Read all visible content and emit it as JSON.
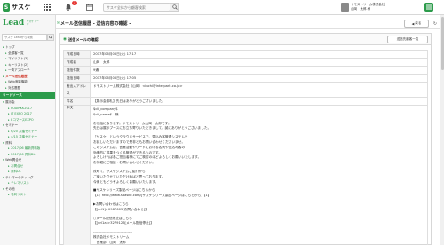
{
  "topbar": {
    "logo_mark": "S",
    "logo_text": "サスケ",
    "bell_count": "3",
    "search_placeholder": "サスケ全体から顧客検索",
    "user_org": "ドモストリーム株式会社",
    "user_name": "山岡　太郎 様"
  },
  "sidebar": {
    "logo": "Lead",
    "logo_sub": "サスケ リード",
    "search_placeholder": "サスケ Leadから検索",
    "items_top": [
      {
        "label": "トップ",
        "type": "plain"
      },
      {
        "label": "全顧客一覧",
        "type": "sub"
      },
      {
        "label": "マイリスト(3)",
        "type": "sub"
      },
      {
        "label": "キーリスト(2)",
        "type": "sub"
      },
      {
        "label": "一斉アプローチ",
        "type": "sub"
      },
      {
        "label": "メール送信履歴",
        "type": "active"
      },
      {
        "label": "Web追跡機能",
        "type": "sub"
      },
      {
        "label": "対応履歴",
        "type": "sub"
      }
    ],
    "section_label": "リードソース",
    "items_source": [
      {
        "label": "展示会",
        "type": "head"
      },
      {
        "label": "PUAIRKK2017",
        "type": "sub2"
      },
      {
        "label": "IT EXPO 2017",
        "type": "sub2"
      },
      {
        "label": "EコマースEXPO",
        "type": "sub2"
      },
      {
        "label": "セミナー",
        "type": "head"
      },
      {
        "label": "6/20 共催セミナー",
        "type": "sub2"
      },
      {
        "label": "4/15 共催セミナー",
        "type": "sub2"
      },
      {
        "label": "資料",
        "type": "head"
      },
      {
        "label": "2017/06 最新資料版",
        "type": "sub2"
      },
      {
        "label": "2017/06 資料DL",
        "type": "sub2"
      },
      {
        "label": "Web問合せ",
        "type": "head"
      },
      {
        "label": "お問合せ",
        "type": "sub2"
      },
      {
        "label": "資料DL",
        "type": "sub2"
      },
      {
        "label": "テレマーケティング",
        "type": "head"
      },
      {
        "label": "テレマリスト",
        "type": "sub2"
      },
      {
        "label": "その他",
        "type": "head"
      },
      {
        "label": "名刺リスト",
        "type": "sub2"
      }
    ]
  },
  "page": {
    "title": "メール送信履歴 - 送信内容の確認 -",
    "back_label": "戻る",
    "panel_title": "送信メールの確認",
    "list_button": "送信先顧客一覧",
    "rows": [
      {
        "label": "作成日時",
        "value": "2017年06月06日(火) 17:17"
      },
      {
        "label": "作成者",
        "value": "山岡　太郎"
      },
      {
        "label": "送信件数",
        "value": "9通"
      },
      {
        "label": "送信日時",
        "value": "2017年06月06日(火) 17:05"
      },
      {
        "label": "差出人アドレス",
        "value": "ドモストリーム株式会社（山岡）<inchi@interpark.co.jp>"
      },
      {
        "label": "件名",
        "value": "【展示会御礼】先日はありがとうございました。"
      }
    ],
    "body_label": "本文",
    "body_lines": [
      "$cli_company$",
      "$cli_name$　様",
      "",
      "お世話になります。ドモストリーム山岡　太郎です。",
      "先日は展示ブースにお立ち寄りいただきまして、誠にありがとうございました。",
      "",
      "「サスケ」というクラウドサービスで、見込み客管理システムを",
      "お試しいただけますので是非ともお問い合わせくださいませ。",
      "このシステムは、営業活動やリードにおける名刺や見込み客の",
      "効率的に成果をつくる管理ができるものです。",
      "よろしければ各ご担当者様にてご検討のほどよろしくお願いいたします。",
      "お気軽にご相談・お問い合わせください。",
      "",
      "改めて、サスケシステムご紹介から",
      "ご案いたさせていただければと思っております。",
      "今後ともどうぞよろしくお願いいたします。",
      "",
      "■サスケシリーズ製品ページはこちらから",
      "【1】http://www.saaske.com/[サスケシリーズ製品ページはこちらから]【1】",
      "",
      "▶お問い合わせはこちら",
      "【[url1]>0987605[お問い合わせ]】",
      "",
      "○メール配信停止はこちら",
      "【[url1a]>3279126[メール配信停止]】",
      "",
      "---------------------------------",
      "株式会社ドモストリーム",
      "　営業部　山岡　太郎",
      "---------------------------------"
    ]
  }
}
